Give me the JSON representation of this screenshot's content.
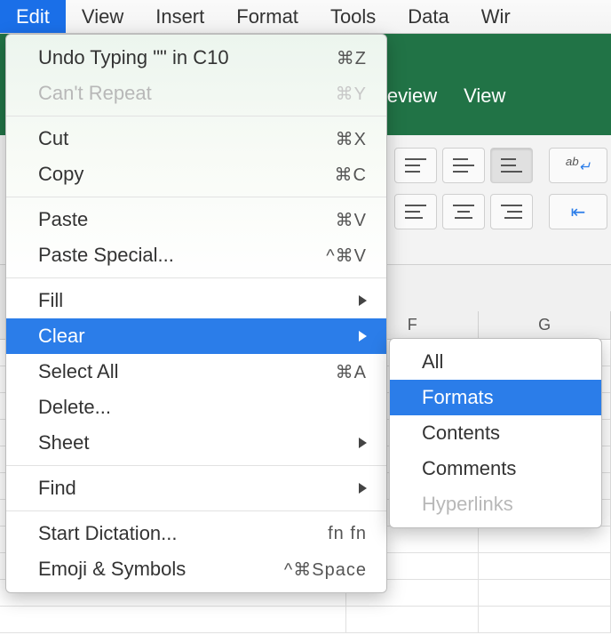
{
  "menubar": {
    "items": [
      "Edit",
      "View",
      "Insert",
      "Format",
      "Tools",
      "Data",
      "Wir"
    ],
    "active_index": 0
  },
  "ribbon": {
    "tabs": [
      "Review",
      "View"
    ]
  },
  "columns": [
    "F",
    "G"
  ],
  "edit_menu": {
    "undo": {
      "label": "Undo Typing \"\" in C10",
      "shortcut": "⌘Z"
    },
    "repeat": {
      "label": "Can't Repeat",
      "shortcut": "⌘Y"
    },
    "cut": {
      "label": "Cut",
      "shortcut": "⌘X"
    },
    "copy": {
      "label": "Copy",
      "shortcut": "⌘C"
    },
    "paste": {
      "label": "Paste",
      "shortcut": "⌘V"
    },
    "paste_special": {
      "label": "Paste Special...",
      "shortcut": "^⌘V"
    },
    "fill": {
      "label": "Fill"
    },
    "clear": {
      "label": "Clear"
    },
    "select_all": {
      "label": "Select All",
      "shortcut": "⌘A"
    },
    "delete": {
      "label": "Delete..."
    },
    "sheet": {
      "label": "Sheet"
    },
    "find": {
      "label": "Find"
    },
    "dictation": {
      "label": "Start Dictation...",
      "shortcut": "fn fn"
    },
    "emoji": {
      "label": "Emoji & Symbols",
      "shortcut": "^⌘Space"
    }
  },
  "clear_menu": {
    "all": "All",
    "formats": "Formats",
    "contents": "Contents",
    "comments": "Comments",
    "hyperlinks": "Hyperlinks"
  }
}
